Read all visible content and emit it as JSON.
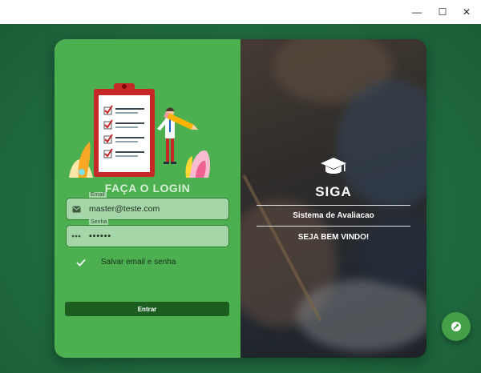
{
  "window": {
    "minimize_glyph": "—",
    "maximize_glyph": "☐",
    "close_glyph": "✕"
  },
  "login": {
    "title": "FAÇA O LOGIN",
    "email": {
      "label": "Email",
      "value": "master@teste.com",
      "icon": "email-icon"
    },
    "password": {
      "label": "Senha",
      "value": "••••••",
      "icon": "password-dots-icon"
    },
    "remember": {
      "label": "Salvar email e senha",
      "checked": true
    },
    "submit_label": "Entrar"
  },
  "brand": {
    "icon": "graduation-cap-icon",
    "name": "SIGA",
    "subtitle": "Sistema de Avaliacao",
    "welcome": "SEJA BEM VINDO!"
  },
  "fab": {
    "icon": "wrench-icon"
  },
  "colors": {
    "background": "#1f6a3f",
    "panel": "#4caf50",
    "field": "#a5d6a7",
    "button": "#1b5e20",
    "fab": "#43a047"
  }
}
